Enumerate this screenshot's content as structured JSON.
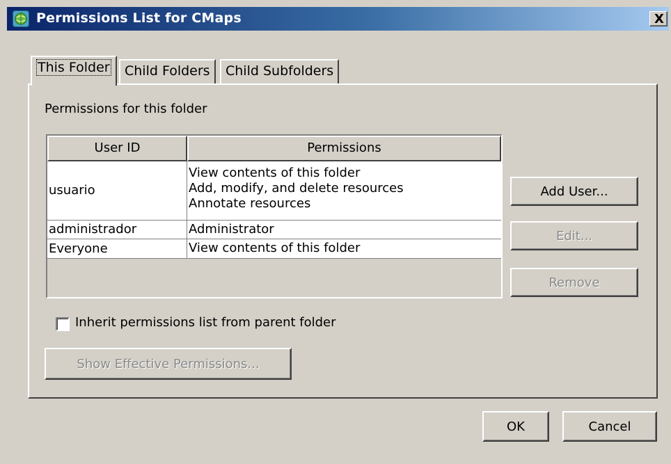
{
  "window": {
    "title": "Permissions List for CMaps",
    "close_glyph": "X",
    "icon": "cmap-globe-icon"
  },
  "tabs": [
    {
      "label": "This Folder",
      "active": true
    },
    {
      "label": "Child Folders",
      "active": false
    },
    {
      "label": "Child Subfolders",
      "active": false
    }
  ],
  "panel": {
    "heading": "Permissions for this folder"
  },
  "table": {
    "headers": [
      "User ID",
      "Permissions"
    ],
    "rows": [
      {
        "user": "usuario",
        "permissions": [
          "View contents of this folder",
          "Add, modify, and delete resources",
          "Annotate resources"
        ]
      },
      {
        "user": "administrador",
        "permissions": [
          "Administrator"
        ]
      },
      {
        "user": "Everyone",
        "permissions": [
          "View contents of this folder"
        ]
      }
    ]
  },
  "side_buttons": {
    "add_user": "Add User...",
    "edit": "Edit...",
    "remove": "Remove"
  },
  "inherit": {
    "label": "Inherit permissions list from parent folder",
    "checked": false
  },
  "show_effective": "Show Effective Permissions...",
  "footer": {
    "ok": "OK",
    "cancel": "Cancel"
  }
}
